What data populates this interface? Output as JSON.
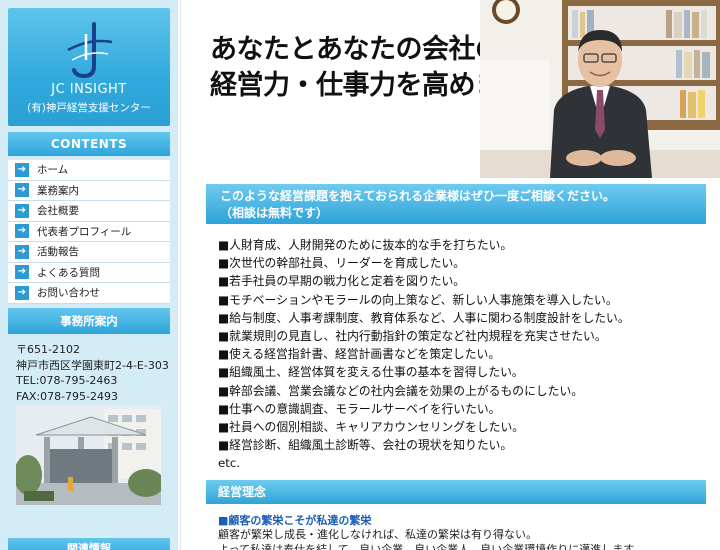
{
  "logo": {
    "name": "JC INSIGHT",
    "subtitle": "(有)神戸経営支援センター"
  },
  "sidebar": {
    "contents_heading": "CONTENTS",
    "items": [
      {
        "label": "ホーム"
      },
      {
        "label": "業務案内"
      },
      {
        "label": "会社概要"
      },
      {
        "label": "代表者プロフィール"
      },
      {
        "label": "活動報告"
      },
      {
        "label": "よくある質問"
      },
      {
        "label": "お問い合わせ"
      }
    ],
    "office_heading": "事務所案内",
    "office": {
      "postal": "〒651-2102",
      "address": "神戸市西区学園東町2-4-E-303",
      "tel": "TEL:078-795-2463",
      "fax": "FAX:078-795-2493"
    },
    "bottom_heading": "関連情報"
  },
  "hero": {
    "line1": "あなたとあなたの会社の",
    "line2": "経営力・仕事力を高めます。"
  },
  "banner": {
    "line1": "このような経営課題を抱えておられる企業様はぜひ一度ご相談ください。",
    "line2": "（相談は無料です）"
  },
  "issues": [
    "■人財育成、人財開発のために抜本的な手を打ちたい。",
    "■次世代の幹部社員、リーダーを育成したい。",
    "■若手社員の早期の戦力化と定着を図りたい。",
    "■モチベーションやモラールの向上策など、新しい人事施策を導入したい。",
    "■給与制度、人事考課制度、教育体系など、人事に関わる制度設計をしたい。",
    "■就業規則の見直し、社内行動指針の策定など社内規程を充実させたい。",
    "■使える経営指針書、経営計画書などを策定したい。",
    "■組織風土、経営体質を変える仕事の基本を習得したい。",
    "■幹部会議、営業会議などの社内会議を効果の上がるものにしたい。",
    "■仕事への意識調査、モラールサーベイを行いたい。",
    "■社員への個別相談、キャリアカウンセリングをしたい。",
    "■経営診断、組織風土診断等、会社の現状を知りたい。",
    "etc."
  ],
  "philosophy": {
    "heading": "経営理念",
    "title": "■顧客の繁栄こそが私達の繁栄",
    "text1": "顧客が繁栄し成長・進化しなければ、私達の繁栄は有り得ない。",
    "text2": "よって私達は奉仕を結して、良い企業、良い企業人、良い企業環境作りに邁進します。"
  },
  "colors": {
    "accent": "#2fa3d8",
    "sidebar_bg": "#d4ecf6",
    "link_blue": "#1a5fb4"
  }
}
